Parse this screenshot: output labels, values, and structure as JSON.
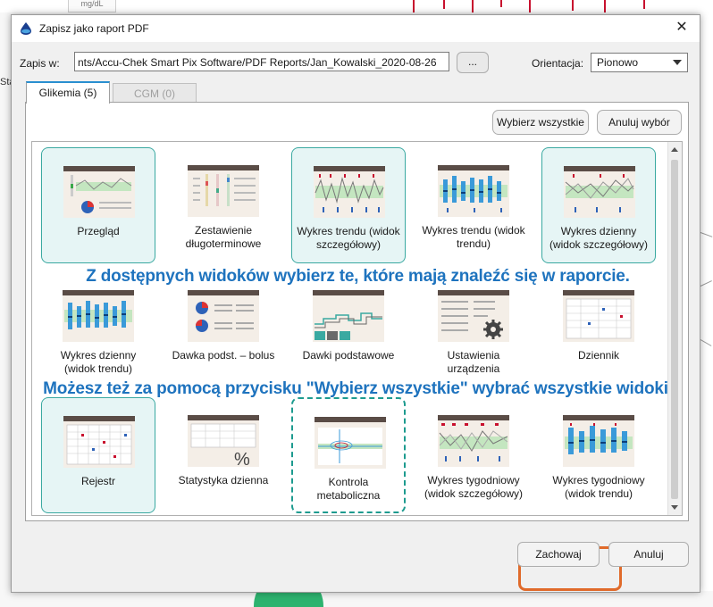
{
  "background": {
    "unit_label": "mg/dL",
    "left_label": "Sta"
  },
  "dialog": {
    "title": "Zapisz jako raport PDF",
    "close_label": "✕",
    "save_label": "Zapis w:",
    "path_value": "nts/Accu-Chek Smart Pix Software/PDF Reports/Jan_Kowalski_2020-08-26",
    "browse_label": "...",
    "orientation_label": "Orientacja:",
    "orientation_value": "Pionowo",
    "tabs": [
      {
        "label": "Glikemia (5)",
        "active": true
      },
      {
        "label": "CGM (0)",
        "active": false
      }
    ],
    "select_all_label": "Wybierz wszystkie",
    "deselect_label": "Anuluj wybór",
    "overlay_1": "Z dostępnych widoków wybierz te, które mają znaleźć się w raporcie.",
    "overlay_2": "Możesz też za pomocą przycisku \"Wybierz wszystkie\" wybrać wszystkie widoki.",
    "views": [
      {
        "label": "Przegląd",
        "icon": "overview-report-icon",
        "selected": true
      },
      {
        "label": "Zestawienie długoterminowe",
        "icon": "long-term-summary-icon",
        "selected": false
      },
      {
        "label": "Wykres trendu (widok szczegółowy)",
        "icon": "trend-chart-detail-icon",
        "selected": true
      },
      {
        "label": "Wykres trendu (widok trendu)",
        "icon": "trend-chart-trend-icon",
        "selected": false
      },
      {
        "label": "Wykres dzienny (widok szczegółowy)",
        "icon": "daily-chart-detail-icon",
        "selected": true
      },
      {
        "label": "Wykres dzienny (widok trendu)",
        "icon": "daily-chart-trend-icon",
        "selected": false
      },
      {
        "label": "Dawka podst. – bolus",
        "icon": "basal-bolus-icon",
        "selected": false
      },
      {
        "label": "Dawki podstawowe",
        "icon": "basal-doses-icon",
        "selected": false
      },
      {
        "label": "Ustawienia urządzenia",
        "icon": "device-settings-icon",
        "selected": false
      },
      {
        "label": "Dziennik",
        "icon": "logbook-icon",
        "selected": false
      },
      {
        "label": "Rejestr",
        "icon": "register-icon",
        "selected": true
      },
      {
        "label": "Statystyka dzienna",
        "icon": "daily-statistics-icon",
        "selected": false
      },
      {
        "label": "Kontrola metaboliczna",
        "icon": "metabolic-control-icon",
        "selected": false
      },
      {
        "label": "Wykres tygodniowy (widok szczegółowy)",
        "icon": "weekly-chart-detail-icon",
        "selected": false
      },
      {
        "label": "Wykres tygodniowy (widok trendu)",
        "icon": "weekly-chart-trend-icon",
        "selected": false
      }
    ],
    "save_button_label": "Zachowaj",
    "cancel_button_label": "Anuluj",
    "colors": {
      "accent": "#1e73be",
      "selected_bg": "#e6f5f5",
      "selected_border": "#3aa9a1",
      "highlight": "#e06a2a",
      "tab_accent": "#2a8fd0"
    }
  }
}
